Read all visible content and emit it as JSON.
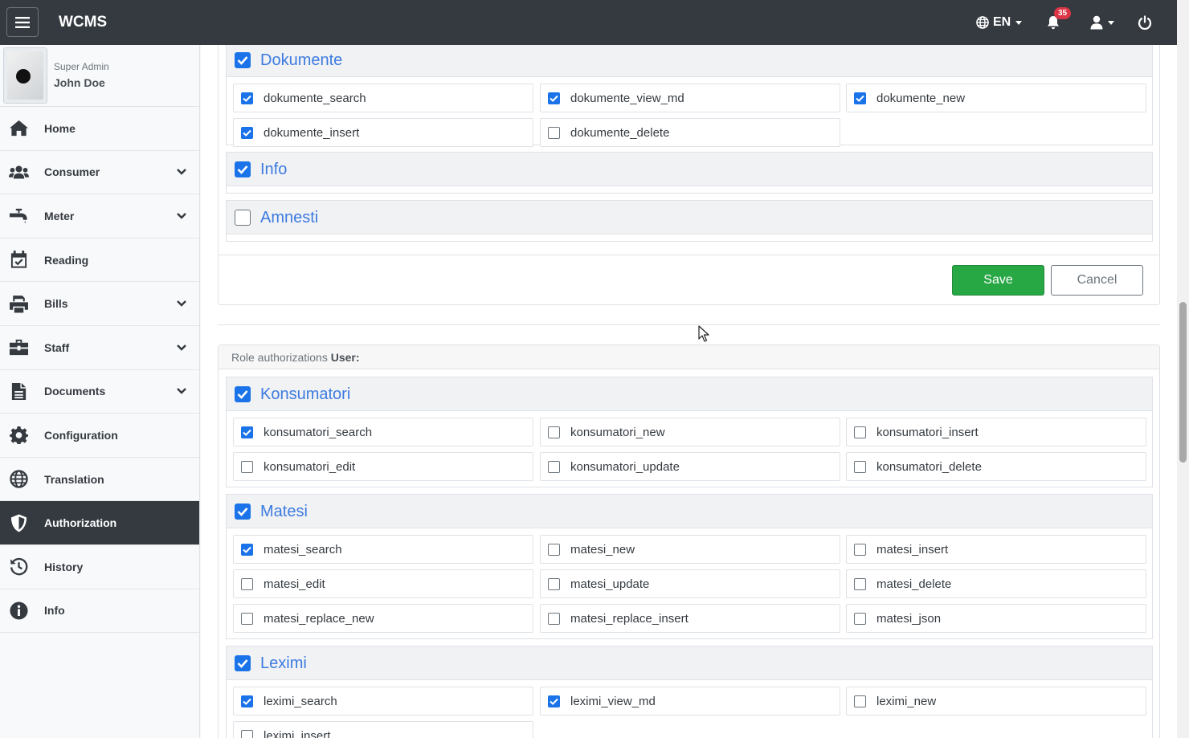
{
  "navbar": {
    "brand": "WCMS",
    "language": "EN",
    "notification_count": "35"
  },
  "user": {
    "role": "Super Admin",
    "name": "John Doe"
  },
  "sidebar": {
    "items": [
      {
        "label": "Home",
        "icon": "home-icon"
      },
      {
        "label": "Consumer",
        "icon": "users-icon"
      },
      {
        "label": "Meter",
        "icon": "faucet-icon"
      },
      {
        "label": "Reading",
        "icon": "calendar-check-icon"
      },
      {
        "label": "Bills",
        "icon": "printer-icon"
      },
      {
        "label": "Staff",
        "icon": "briefcase-icon"
      },
      {
        "label": "Documents",
        "icon": "document-icon"
      },
      {
        "label": "Configuration",
        "icon": "gear-icon"
      },
      {
        "label": "Translation",
        "icon": "globe-icon"
      },
      {
        "label": "Authorization",
        "icon": "shield-icon",
        "active": true
      },
      {
        "label": "History",
        "icon": "history-icon"
      },
      {
        "label": "Info",
        "icon": "info-icon"
      }
    ]
  },
  "admin_card": {
    "groups": [
      {
        "title": "Dokumente",
        "checked": true,
        "perms": [
          {
            "label": "dokumente_search",
            "checked": true
          },
          {
            "label": "dokumente_view_md",
            "checked": true
          },
          {
            "label": "dokumente_new",
            "checked": true
          },
          {
            "label": "dokumente_insert",
            "checked": true
          },
          {
            "label": "dokumente_delete",
            "checked": false
          }
        ]
      },
      {
        "title": "Info",
        "checked": true,
        "perms": []
      },
      {
        "title": "Amnesti",
        "checked": false,
        "perms": []
      }
    ],
    "save_label": "Save",
    "cancel_label": "Cancel"
  },
  "user_card": {
    "header_prefix": "Role authorizations",
    "header_role": "User:",
    "groups": [
      {
        "title": "Konsumatori",
        "checked": true,
        "perms": [
          {
            "label": "konsumatori_search",
            "checked": true
          },
          {
            "label": "konsumatori_new",
            "checked": false
          },
          {
            "label": "konsumatori_insert",
            "checked": false
          },
          {
            "label": "konsumatori_edit",
            "checked": false
          },
          {
            "label": "konsumatori_update",
            "checked": false
          },
          {
            "label": "konsumatori_delete",
            "checked": false
          }
        ]
      },
      {
        "title": "Matesi",
        "checked": true,
        "perms": [
          {
            "label": "matesi_search",
            "checked": true
          },
          {
            "label": "matesi_new",
            "checked": false
          },
          {
            "label": "matesi_insert",
            "checked": false
          },
          {
            "label": "matesi_edit",
            "checked": false
          },
          {
            "label": "matesi_update",
            "checked": false
          },
          {
            "label": "matesi_delete",
            "checked": false
          },
          {
            "label": "matesi_replace_new",
            "checked": false
          },
          {
            "label": "matesi_replace_insert",
            "checked": false
          },
          {
            "label": "matesi_json",
            "checked": false
          }
        ]
      },
      {
        "title": "Leximi",
        "checked": true,
        "perms": [
          {
            "label": "leximi_search",
            "checked": true
          },
          {
            "label": "leximi_view_md",
            "checked": true
          },
          {
            "label": "leximi_new",
            "checked": false
          },
          {
            "label": "leximi_insert",
            "checked": false
          }
        ]
      }
    ]
  },
  "colors": {
    "navbar": "#343a40",
    "accent": "#1a73e8",
    "group_title": "#3c7be0",
    "save": "#28a745",
    "badge": "#dc3545"
  }
}
